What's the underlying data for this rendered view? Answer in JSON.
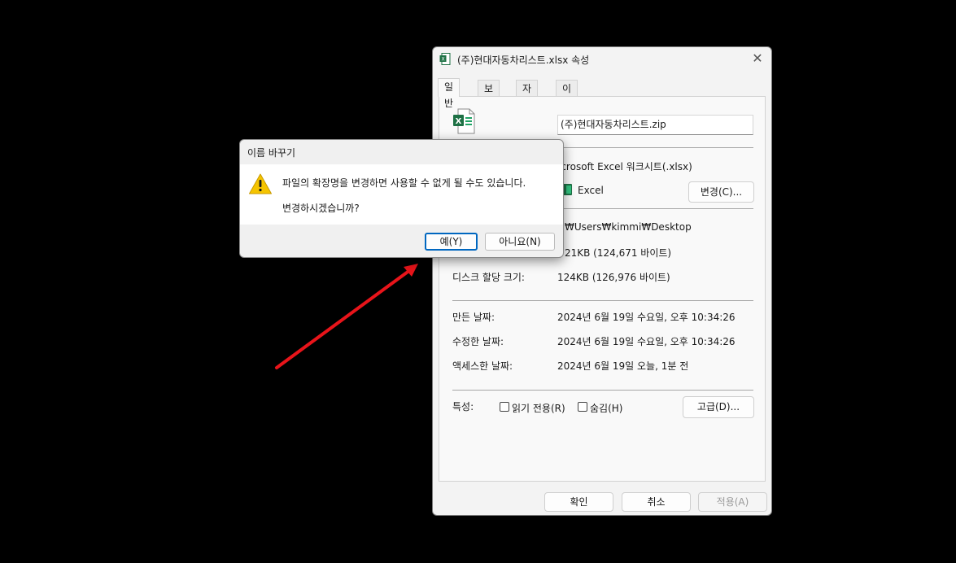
{
  "properties": {
    "title": "(주)현대자동차리스트.xlsx 속성",
    "tabs": [
      "일반",
      "보안",
      "자세히",
      "이전 버전"
    ],
    "file_name": "(주)현대자동차리스트.zip",
    "file_type": "icrosoft Excel 워크시트(.xlsx)",
    "opens_with": "Excel",
    "change_button": "변경(C)...",
    "location": "₩Users₩kimmi₩Desktop",
    "size": "21KB (124,671 바이트)",
    "disk_size_label": "디스크 할당 크기:",
    "disk_size": "124KB (126,976 바이트)",
    "created_label": "만든 날짜:",
    "created": "2024년 6월 19일 수요일, 오후 10:34:26",
    "modified_label": "수정한 날짜:",
    "modified": "2024년 6월 19일 수요일, 오후 10:34:26",
    "accessed_label": "액세스한 날짜:",
    "accessed": "2024년 6월 19일 오늘, 1분 전",
    "attributes_label": "특성:",
    "readonly_label": "읽기 전용(R)",
    "hidden_label": "숨김(H)",
    "advanced_button": "고급(D)...",
    "ok_button": "확인",
    "cancel_button": "취소",
    "apply_button": "적용(A)"
  },
  "rename_dialog": {
    "title": "이름 바꾸기",
    "message_line1": "파일의 확장명을 변경하면 사용할 수 없게 될 수도 있습니다.",
    "message_line2": "변경하시겠습니까?",
    "yes_button": "예(Y)",
    "no_button": "아니요(N)"
  },
  "colors": {
    "arrow": "#e8141a",
    "excel_green": "#1e7145",
    "warning_yellow": "#f5c400",
    "focus_blue": "#0067c0"
  },
  "icons": [
    "excel-file-icon",
    "close-icon",
    "warning-icon",
    "excel-small-icon"
  ]
}
